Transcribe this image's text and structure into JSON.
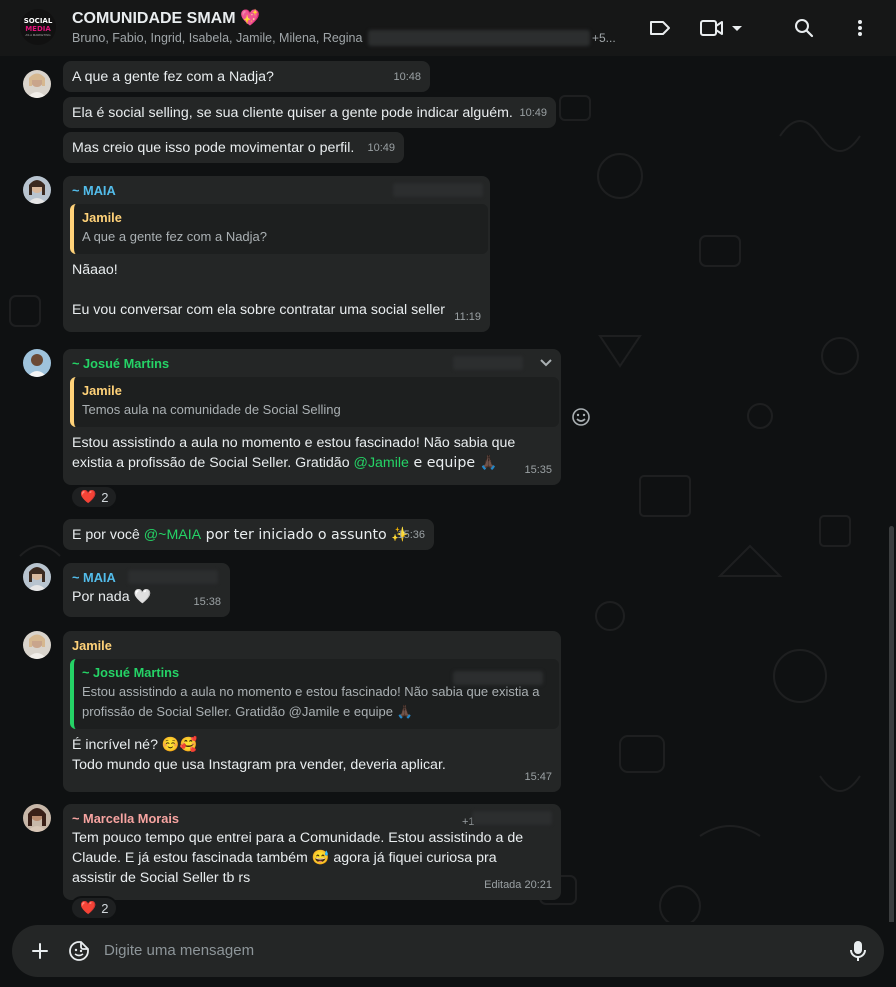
{
  "header": {
    "group_name": "COMUNIDADE SMAM 💖",
    "participants": "Bruno, Fabio, Ingrid, Isabela, Jamile, Milena, Regina",
    "participants_more": "+5...",
    "avatar_line1": "SOCIAL",
    "avatar_line2": "MEDIA",
    "avatar_line3": "AS A MARKETING"
  },
  "messages": [
    {
      "text": "A que a gente fez com a Nadja?",
      "time": "10:48"
    },
    {
      "text": "Ela é social selling, se sua cliente quiser a gente pode indicar alguém.",
      "time": "10:49"
    },
    {
      "text": "Mas creio que isso pode movimentar o perfil.",
      "time": "10:49"
    },
    {
      "sender": "~ MAIA",
      "quote_name": "Jamile",
      "quote_text": "A que a gente fez com a Nadja?",
      "line1": "Nãaao!",
      "line2": "Eu vou conversar com ela sobre contratar uma social seller",
      "time": "11:19"
    },
    {
      "sender": "~ Josué Martins",
      "quote_name": "Jamile",
      "quote_text": "Temos aula na comunidade de Social  Selling",
      "line1": "Estou assistindo a aula no momento e estou fascinado! Não sabia que",
      "line2a": "existia a profissão de Social Seller. Gratidão ",
      "mention": "@Jamile",
      "line2b": " e equipe 🙏🏿",
      "time": "15:35",
      "reaction_count": "2"
    },
    {
      "text_a": "E por você ",
      "mention": "@~MAIA",
      "text_b": " por ter iniciado o assunto ✨",
      "time": "15:36"
    },
    {
      "sender": "~ MAIA",
      "text": "Por nada 🤍",
      "time": "15:38"
    },
    {
      "sender": "Jamile",
      "quote_name": "~ Josué Martins",
      "quote_line1": "Estou assistindo a aula no momento e estou fascinado! Não sabia que existia a",
      "quote_line2": "profissão de Social Seller. Gratidão @Jamile e equipe 🙏🏿",
      "line1": "É incrível né?  ☺️🥰",
      "line2": "Todo mundo que usa Instagram pra vender, deveria aplicar.",
      "time": "15:47"
    },
    {
      "sender": "~ Marcella Morais",
      "phone_prefix": "+1",
      "line1": "Tem pouco tempo que entrei para a Comunidade. Estou assistindo a de",
      "line2": "Claude. E já estou fascinada também 😅 agora já fiquei curiosa pra",
      "line3": "assistir de Social Seller tb rs",
      "time": "Editada 20:21",
      "reaction_count": "2"
    }
  ],
  "reaction_emoji": "❤️",
  "composer": {
    "placeholder": "Digite uma mensagem"
  },
  "colors": {
    "accent": "#25d366",
    "mention": "#25d366",
    "bubble": "#242626",
    "background": "#0f1112"
  }
}
